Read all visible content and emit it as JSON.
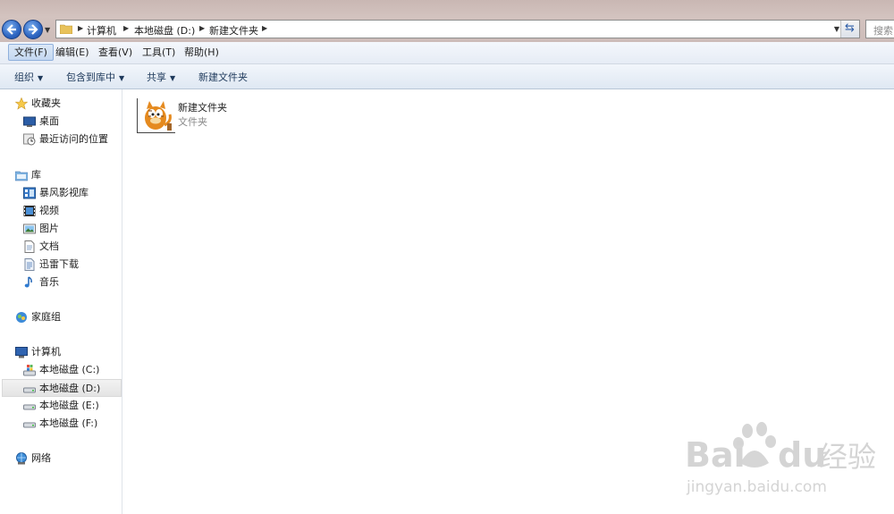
{
  "address_bar": {
    "crumbs": [
      "计算机",
      "本地磁盘 (D:)",
      "新建文件夹"
    ]
  },
  "search": {
    "placeholder": "搜索"
  },
  "menu": [
    "文件(F)",
    "编辑(E)",
    "查看(V)",
    "工具(T)",
    "帮助(H)"
  ],
  "commands": {
    "organize": "组织",
    "include_in_library": "包含到库中",
    "share": "共享",
    "new_folder": "新建文件夹"
  },
  "nav_pane": {
    "favorites": {
      "label": "收藏夹",
      "items": [
        "桌面",
        "最近访问的位置"
      ]
    },
    "libraries": {
      "label": "库",
      "items": [
        "暴风影视库",
        "视频",
        "图片",
        "文档",
        "迅雷下载",
        "音乐"
      ]
    },
    "homegroup": {
      "label": "家庭组"
    },
    "computer": {
      "label": "计算机",
      "items": [
        "本地磁盘 (C:)",
        "本地磁盘 (D:)",
        "本地磁盘 (E:)",
        "本地磁盘 (F:)"
      ]
    },
    "network": {
      "label": "网络"
    }
  },
  "content": {
    "items": [
      {
        "name": "新建文件夹",
        "type": "文件夹"
      }
    ]
  },
  "watermark": {
    "brand": "Bai",
    "brand2": "du",
    "cn": "经验",
    "url": "jingyan.baidu.com"
  },
  "colors": {
    "accent": "#2e66c2",
    "selected_bg": "#e8e8e8",
    "menu_active": "#c4d8f1"
  }
}
